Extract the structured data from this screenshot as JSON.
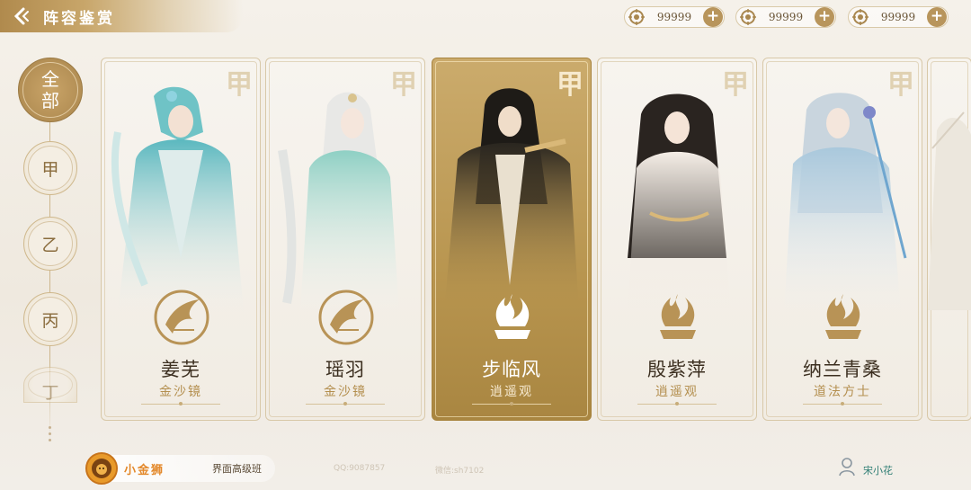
{
  "header": {
    "title": "阵容鉴赏",
    "back_icon": "back-arrow-icon",
    "currencies": [
      {
        "icon": "coin-emblem-icon",
        "amount": "99999"
      },
      {
        "icon": "coin-emblem-icon",
        "amount": "99999"
      },
      {
        "icon": "coin-emblem-icon",
        "amount": "99999"
      }
    ]
  },
  "filters": [
    {
      "label": "全部",
      "active": true
    },
    {
      "label": "甲",
      "active": false
    },
    {
      "label": "乙",
      "active": false
    },
    {
      "label": "丙",
      "active": false
    },
    {
      "label": "丁",
      "active": false
    }
  ],
  "cards": [
    {
      "rank": "甲",
      "name": "姜芜",
      "sect": "金沙镜",
      "emblem": "bird-emblem-icon",
      "selected": false
    },
    {
      "rank": "甲",
      "name": "瑶羽",
      "sect": "金沙镜",
      "emblem": "bird-emblem-icon",
      "selected": false
    },
    {
      "rank": "甲",
      "name": "步临风",
      "sect": "逍遥观",
      "emblem": "flame-emblem-icon",
      "selected": true
    },
    {
      "rank": "甲",
      "name": "殷紫萍",
      "sect": "逍遥观",
      "emblem": "flame-emblem-icon",
      "selected": false
    },
    {
      "rank": "甲",
      "name": "纳兰青桑",
      "sect": "道法方士",
      "emblem": "flame-emblem-icon",
      "selected": false
    }
  ],
  "footer": {
    "brand": "小金狮",
    "course": "界面高级班",
    "qq": "QQ:9087857",
    "wechat": "微信:sh7102",
    "user_name": "宋小花"
  },
  "colors": {
    "gold_accent": "#b8955c",
    "selected_card": "#b8954f",
    "background": "#f2eee8"
  }
}
